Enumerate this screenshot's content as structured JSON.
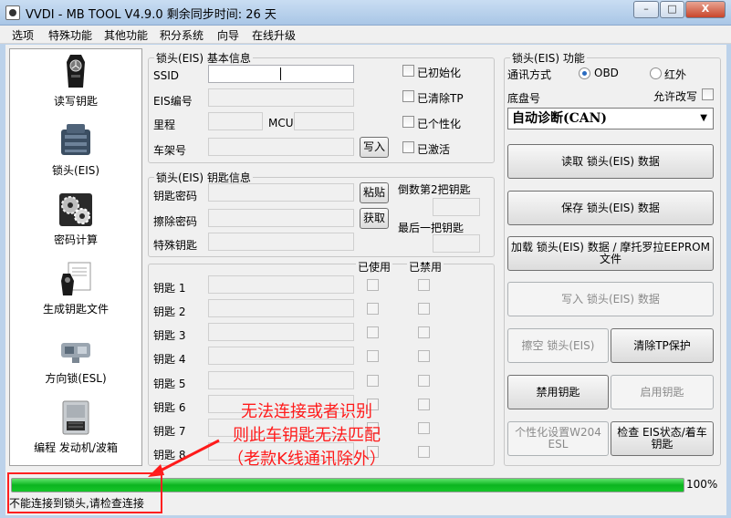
{
  "window": {
    "title": "VVDI - MB TOOL V4.9.0   剩余同步时间: 26 天",
    "buttons": {
      "minimize": "–",
      "maximize": "□",
      "close": "X"
    }
  },
  "menu": [
    "选项",
    "特殊功能",
    "其他功能",
    "积分系统",
    "向导",
    "在线升级"
  ],
  "sidebar": {
    "items": [
      {
        "label": "读写钥匙",
        "icon": "car-key-icon"
      },
      {
        "label": "锁头(EIS)",
        "icon": "eis-module-icon"
      },
      {
        "label": "密码计算",
        "icon": "gears-icon"
      },
      {
        "label": "生成钥匙文件",
        "icon": "key-file-icon"
      },
      {
        "label": "方向锁(ESL)",
        "icon": "esl-module-icon"
      },
      {
        "label": "编程 发动机/波箱",
        "icon": "ecu-icon"
      }
    ]
  },
  "basic_info": {
    "title": "锁头(EIS) 基本信息",
    "ssid_label": "SSID",
    "eis_no_label": "EIS编号",
    "mileage_label": "里程",
    "mcu_label": "MCU",
    "vin_label": "车架号",
    "write_button": "写入",
    "checks": [
      "已初始化",
      "已清除TP",
      "已个性化",
      "已激活"
    ]
  },
  "key_info": {
    "title": "锁头(EIS) 钥匙信息",
    "key_password_label": "钥匙密码",
    "erase_password_label": "擦除密码",
    "special_key_label": "特殊钥匙",
    "paste_button": "粘贴",
    "get_button": "获取",
    "second_last_key_label": "倒数第2把钥匙",
    "last_key_label": "最后一把钥匙",
    "used_header": "已使用",
    "disabled_header": "已禁用",
    "keys": [
      "钥匙 1",
      "钥匙 2",
      "钥匙 3",
      "钥匙 4",
      "钥匙 5",
      "钥匙 6",
      "钥匙 7",
      "钥匙 8"
    ]
  },
  "eis_functions": {
    "title": "锁头(EIS) 功能",
    "comm_label": "通讯方式",
    "obd_label": "OBD",
    "ir_label": "红外",
    "chassis_label": "底盘号",
    "allow_edit_label": "允许改写",
    "chassis_value": "自动诊断(CAN)",
    "buttons": {
      "read": "读取 锁头(EIS) 数据",
      "save": "保存 锁头(EIS) 数据",
      "load": "加载 锁头(EIS) 数据 / 摩托罗拉EEPROM文件",
      "write": "写入 锁头(EIS) 数据",
      "erase": "擦空 锁头(EIS)",
      "clear_tp": "清除TP保护",
      "disable_key": "禁用钥匙",
      "enable_key": "启用钥匙",
      "personalize": "个性化设置W204 ESL",
      "check_status": "检查 EIS状态/着车钥匙"
    }
  },
  "progress": {
    "value": 100,
    "label": "100%"
  },
  "status_text": "不能连接到锁头,请检查连接",
  "annotation": {
    "line1": "无法连接或者识别",
    "line2": "则此车钥匙无法匹配",
    "line3": "（老款K线通讯除外）",
    "color": "#ff1a1a"
  }
}
